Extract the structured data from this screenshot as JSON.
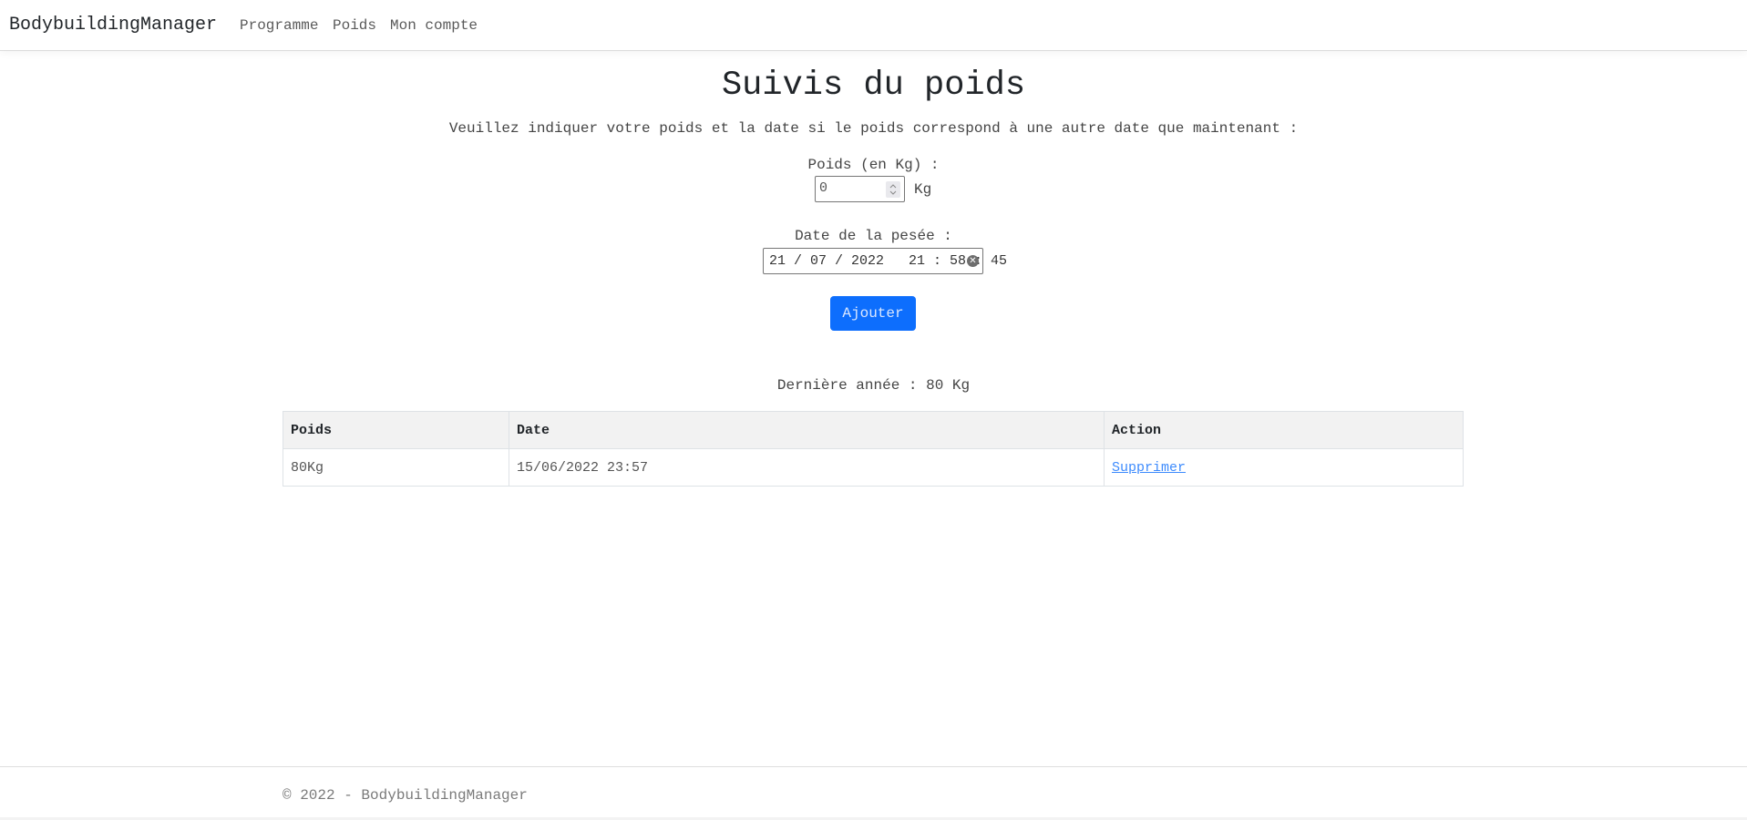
{
  "navbar": {
    "brand": "BodybuildingManager",
    "links": [
      {
        "label": "Programme"
      },
      {
        "label": "Poids"
      },
      {
        "label": "Mon compte"
      }
    ]
  },
  "page": {
    "title": "Suivis du poids",
    "subtitle": "Veuillez indiquer votre poids et la date si le poids correspond à une autre date que maintenant :"
  },
  "form": {
    "weight_label": "Poids (en Kg) :",
    "weight_value": "0",
    "weight_unit": "Kg",
    "date_label": "Date de la pesée :",
    "date_value": "21 / 07 / 2022   21 : 58 : 45",
    "submit_label": "Ajouter"
  },
  "summary": "Dernière année : 80 Kg",
  "table": {
    "headers": [
      "Poids",
      "Date",
      "Action"
    ],
    "rows": [
      {
        "poids": "80Kg",
        "date": "15/06/2022 23:57",
        "action": "Supprimer"
      }
    ]
  },
  "footer": {
    "text": "© 2022 - BodybuildingManager"
  },
  "colors": {
    "primary": "#0d6efd",
    "link": "#3d8bfd",
    "table_header_bg": "#f2f2f2"
  }
}
